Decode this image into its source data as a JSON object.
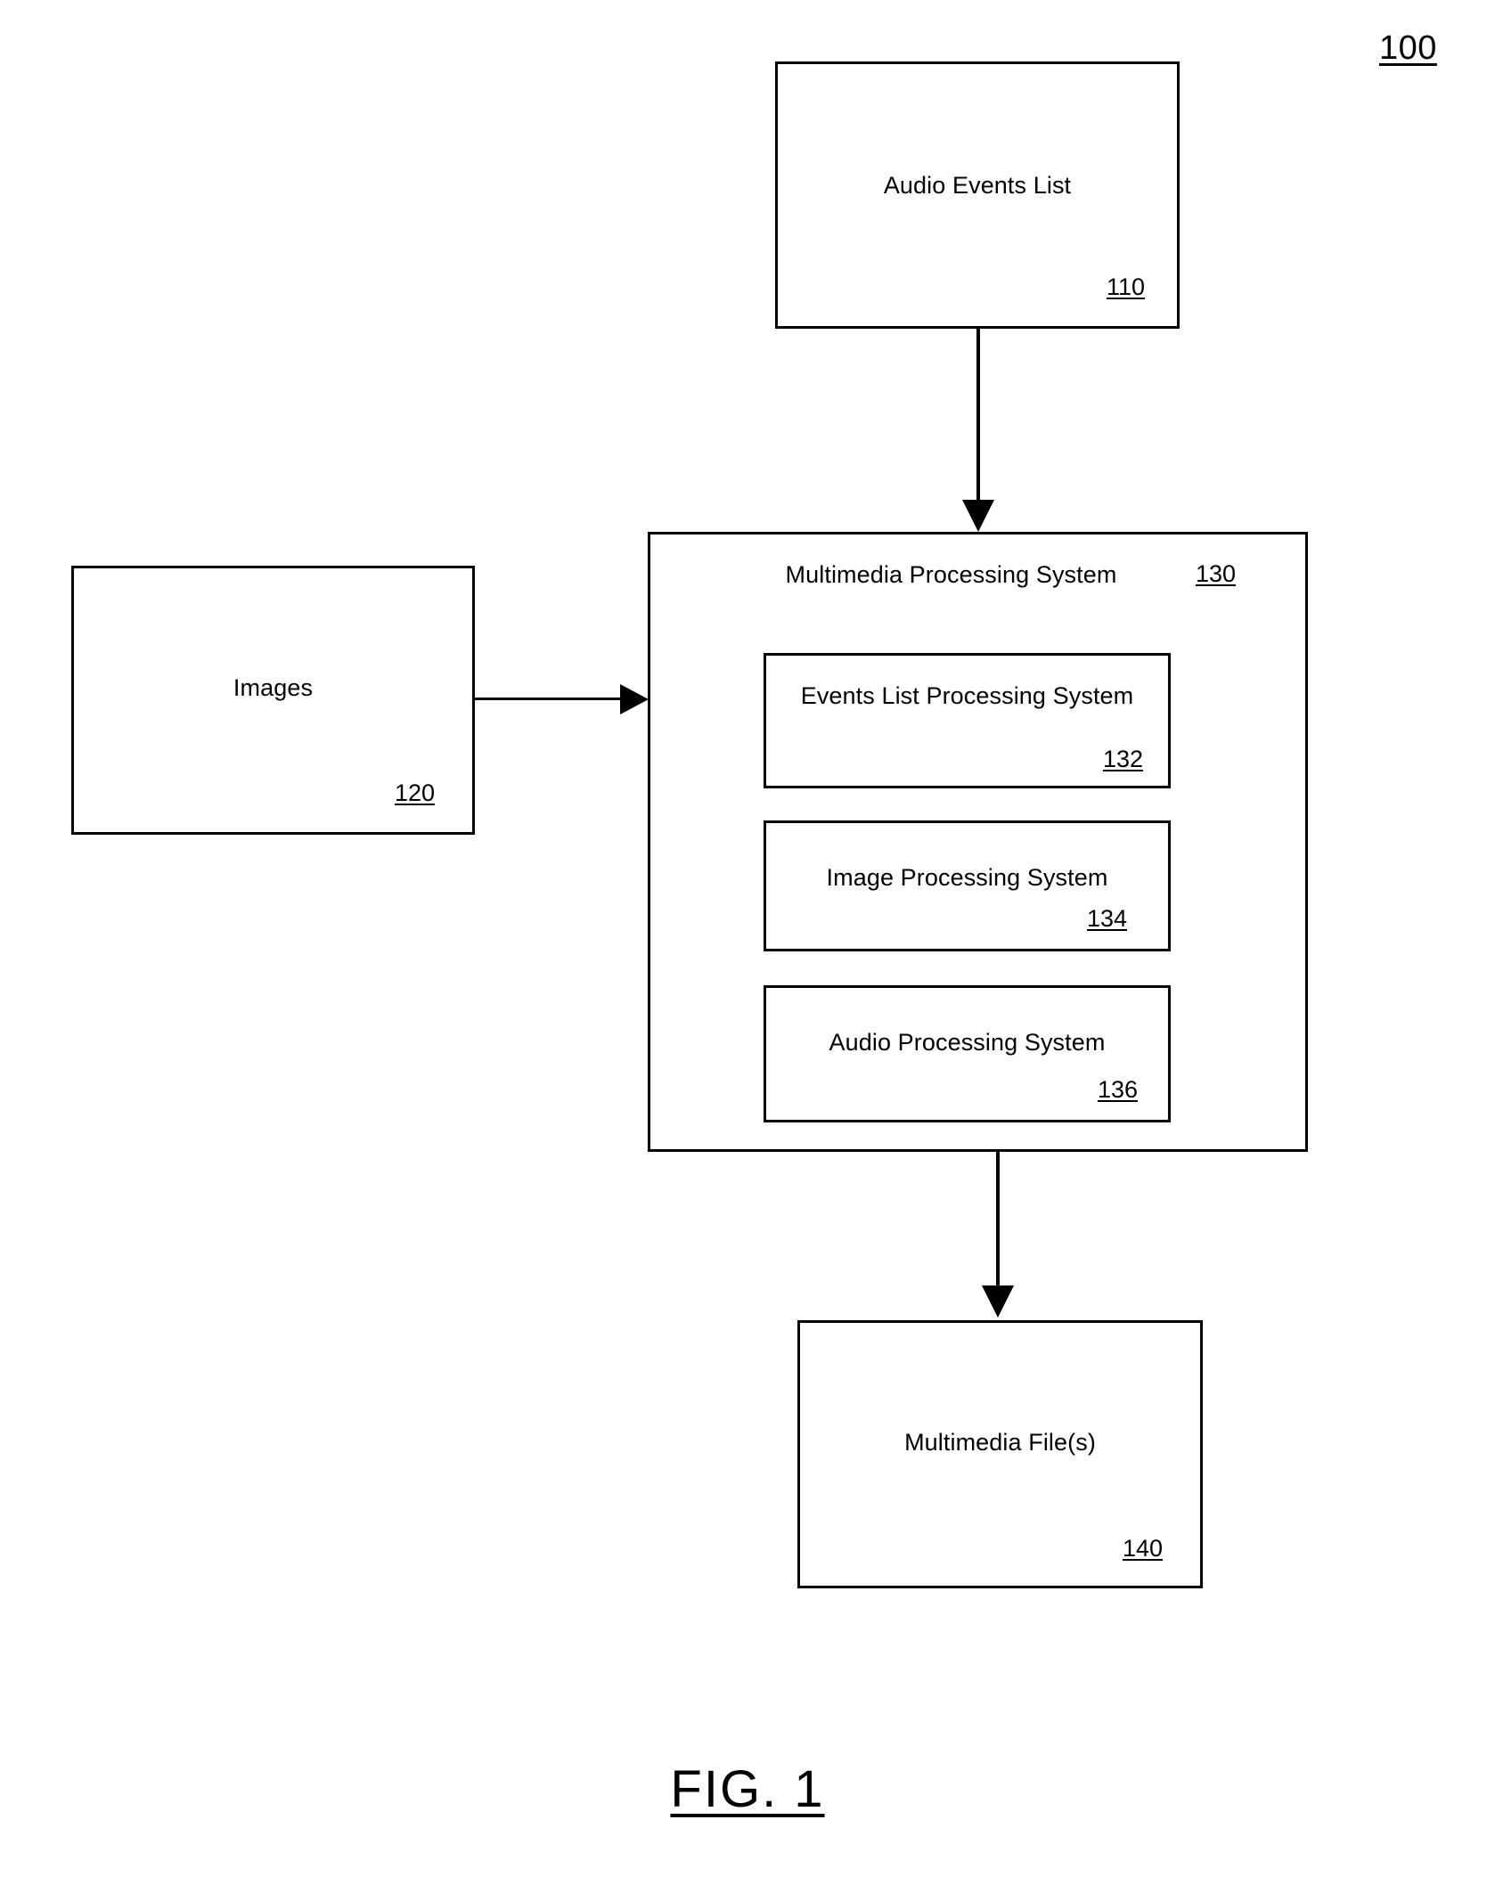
{
  "figure": {
    "number": "100",
    "caption": "FIG. 1"
  },
  "nodes": {
    "audio_events_list": {
      "title": "Audio Events List",
      "ref": "110"
    },
    "images": {
      "title": "Images",
      "ref": "120"
    },
    "multimedia_processing_system": {
      "title": "Multimedia Processing System",
      "ref": "130",
      "children": [
        {
          "title": "Events List Processing System",
          "ref": "132"
        },
        {
          "title": "Image Processing System",
          "ref": "134"
        },
        {
          "title": "Audio Processing System",
          "ref": "136"
        }
      ]
    },
    "multimedia_files": {
      "title": "Multimedia File(s)",
      "ref": "140"
    }
  },
  "connectors": [
    {
      "name": "audio-events-to-system",
      "from": "110",
      "to": "130",
      "direction": "down"
    },
    {
      "name": "images-to-system",
      "from": "120",
      "to": "130",
      "direction": "right"
    },
    {
      "name": "system-to-files",
      "from": "130",
      "to": "140",
      "direction": "down"
    }
  ],
  "colors": {
    "stroke": "#000000",
    "background": "#ffffff",
    "text": "#000000"
  }
}
